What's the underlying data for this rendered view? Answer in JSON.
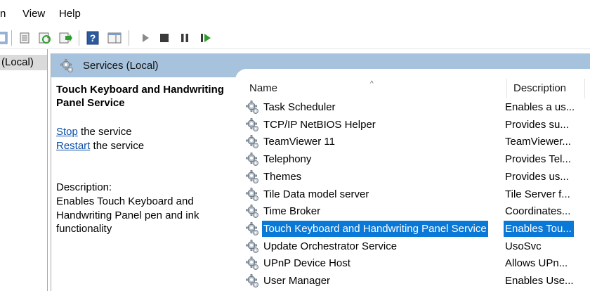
{
  "menu": {
    "items": [
      {
        "label": "n"
      },
      {
        "label": "View"
      },
      {
        "label": "Help"
      }
    ]
  },
  "toolbar": {
    "buttons": [
      {
        "icon": "console-tree-icon"
      },
      {
        "icon": "properties-icon"
      },
      {
        "icon": "refresh-icon"
      },
      {
        "icon": "export-list-icon"
      },
      {
        "icon": "help-icon"
      },
      {
        "icon": "action-pane-icon"
      },
      {
        "icon": "start-service-icon"
      },
      {
        "icon": "stop-service-icon"
      },
      {
        "icon": "pause-service-icon"
      },
      {
        "icon": "restart-service-icon"
      }
    ]
  },
  "tree": {
    "selected_label": "(Local)"
  },
  "main": {
    "header_title": "Services (Local)",
    "detail": {
      "title": "Touch Keyboard and Handwriting Panel Service",
      "stop_link": "Stop",
      "stop_suffix": " the service",
      "restart_link": "Restart",
      "restart_suffix": " the service",
      "description_label": "Description:",
      "description": "Enables Touch Keyboard and Handwriting Panel pen and ink functionality"
    },
    "list": {
      "columns": {
        "name": "Name",
        "description": "Description"
      },
      "sort_indicator": "^",
      "rows": [
        {
          "name": "Task Scheduler",
          "description": "Enables a us..."
        },
        {
          "name": "TCP/IP NetBIOS Helper",
          "description": "Provides su..."
        },
        {
          "name": "TeamViewer 11",
          "description": "TeamViewer..."
        },
        {
          "name": "Telephony",
          "description": "Provides Tel..."
        },
        {
          "name": "Themes",
          "description": "Provides us..."
        },
        {
          "name": "Tile Data model server",
          "description": "Tile Server f..."
        },
        {
          "name": "Time Broker",
          "description": "Coordinates..."
        },
        {
          "name": "Touch Keyboard and Handwriting Panel Service",
          "description": "Enables Tou..."
        },
        {
          "name": "Update Orchestrator Service",
          "description": "UsoSvc"
        },
        {
          "name": "UPnP Device Host",
          "description": "Allows UPn..."
        },
        {
          "name": "User Manager",
          "description": "Enables Use..."
        }
      ],
      "selected_index": 7
    }
  },
  "colors": {
    "header_bg": "#a7c2dc",
    "selection": "#0a78d7",
    "link": "#0b4fa8"
  }
}
